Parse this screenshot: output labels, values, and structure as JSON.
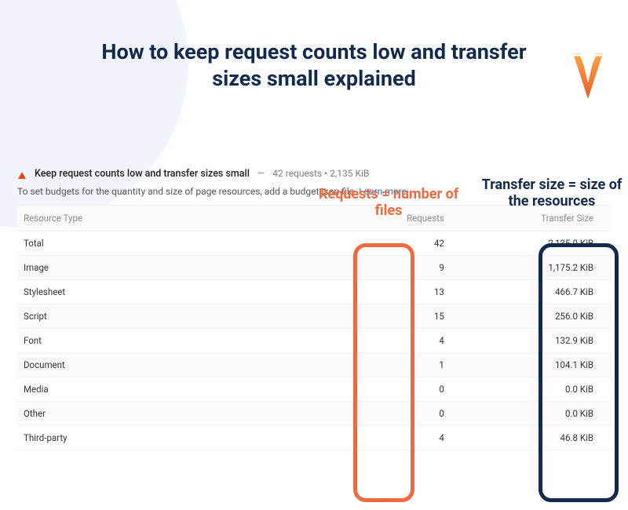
{
  "page": {
    "title": "How to keep request counts low and transfer sizes small explained"
  },
  "audit": {
    "title": "Keep request counts low and transfer sizes small",
    "summary_separator": "—",
    "summary": "42 requests • 2,135 KiB",
    "subtext_pre": "To set budgets for the quantity and size of page resources, add a budget.json file. ",
    "learn_more": "Learn more."
  },
  "table": {
    "headers": {
      "resource": "Resource Type",
      "requests": "Requests",
      "transfer": "Transfer Size"
    },
    "rows": [
      {
        "resource": "Total",
        "requests": "42",
        "transfer": "2,135.0 KiB"
      },
      {
        "resource": "Image",
        "requests": "9",
        "transfer": "1,175.2 KiB"
      },
      {
        "resource": "Stylesheet",
        "requests": "13",
        "transfer": "466.7 KiB"
      },
      {
        "resource": "Script",
        "requests": "15",
        "transfer": "256.0 KiB"
      },
      {
        "resource": "Font",
        "requests": "4",
        "transfer": "132.9 KiB"
      },
      {
        "resource": "Document",
        "requests": "1",
        "transfer": "104.1 KiB"
      },
      {
        "resource": "Media",
        "requests": "0",
        "transfer": "0.0 KiB"
      },
      {
        "resource": "Other",
        "requests": "0",
        "transfer": "0.0 KiB"
      },
      {
        "resource": "Third-party",
        "requests": "4",
        "transfer": "46.8 KiB"
      }
    ]
  },
  "annotations": {
    "requests": "Requests = number of files",
    "transfer": "Transfer size = size of the resources"
  },
  "chart_data": {
    "type": "table",
    "title": "Keep request counts low and transfer sizes small",
    "columns": [
      "Resource Type",
      "Requests",
      "Transfer Size (KiB)"
    ],
    "rows": [
      [
        "Total",
        42,
        2135.0
      ],
      [
        "Image",
        9,
        1175.2
      ],
      [
        "Stylesheet",
        13,
        466.7
      ],
      [
        "Script",
        15,
        256.0
      ],
      [
        "Font",
        4,
        132.9
      ],
      [
        "Document",
        1,
        104.1
      ],
      [
        "Media",
        0,
        0.0
      ],
      [
        "Other",
        0,
        0.0
      ],
      [
        "Third-party",
        4,
        46.8
      ]
    ]
  }
}
